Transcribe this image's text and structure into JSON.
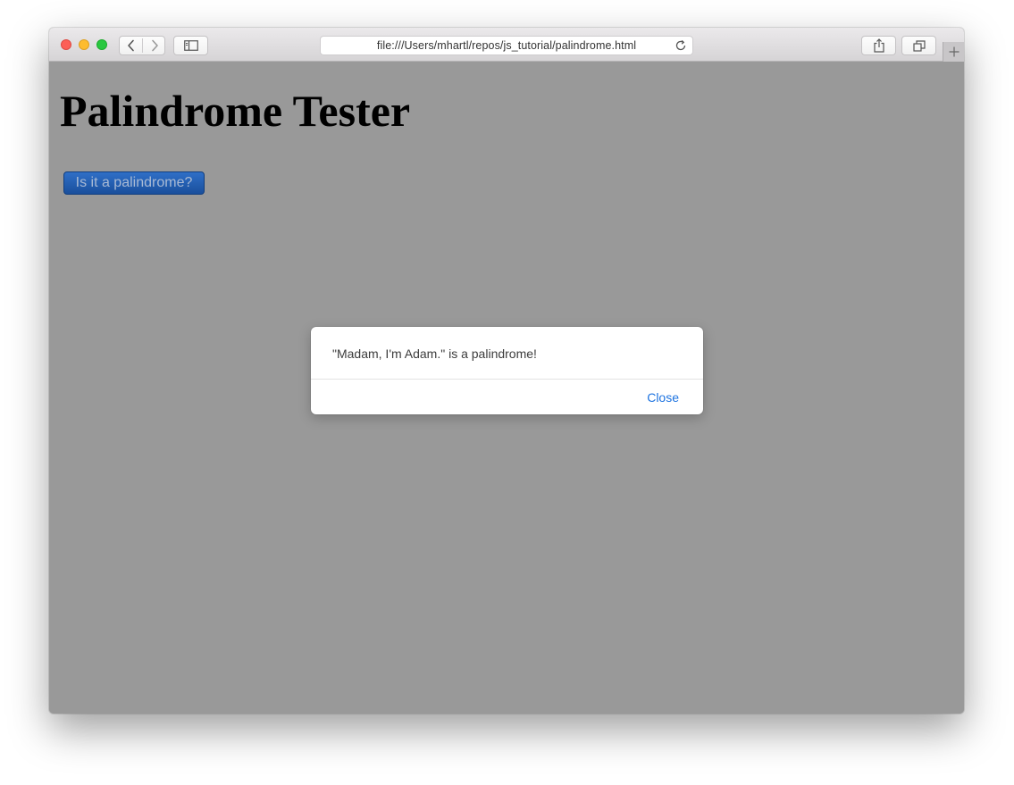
{
  "browser": {
    "address_url": "file:///Users/mhartl/repos/js_tutorial/palindrome.html",
    "icons": {
      "back": "chevron-left-icon",
      "forward": "chevron-right-icon",
      "sidebar": "sidebar-icon",
      "reload": "reload-icon",
      "share": "share-icon",
      "tabs": "tabs-overview-icon",
      "new_tab": "plus-icon"
    },
    "traffic_lights": {
      "close": "#fc5f57",
      "minimize": "#fdbc2e",
      "zoom": "#29c840"
    }
  },
  "page": {
    "background_overlay": "#999999",
    "heading": "Palindrome Tester",
    "button_label": "Is it a palindrome?",
    "button_color": "#2a63b8"
  },
  "dialog": {
    "message": "\"Madam, I'm Adam.\" is a palindrome!",
    "close_label": "Close",
    "close_color": "#1f74e0"
  }
}
